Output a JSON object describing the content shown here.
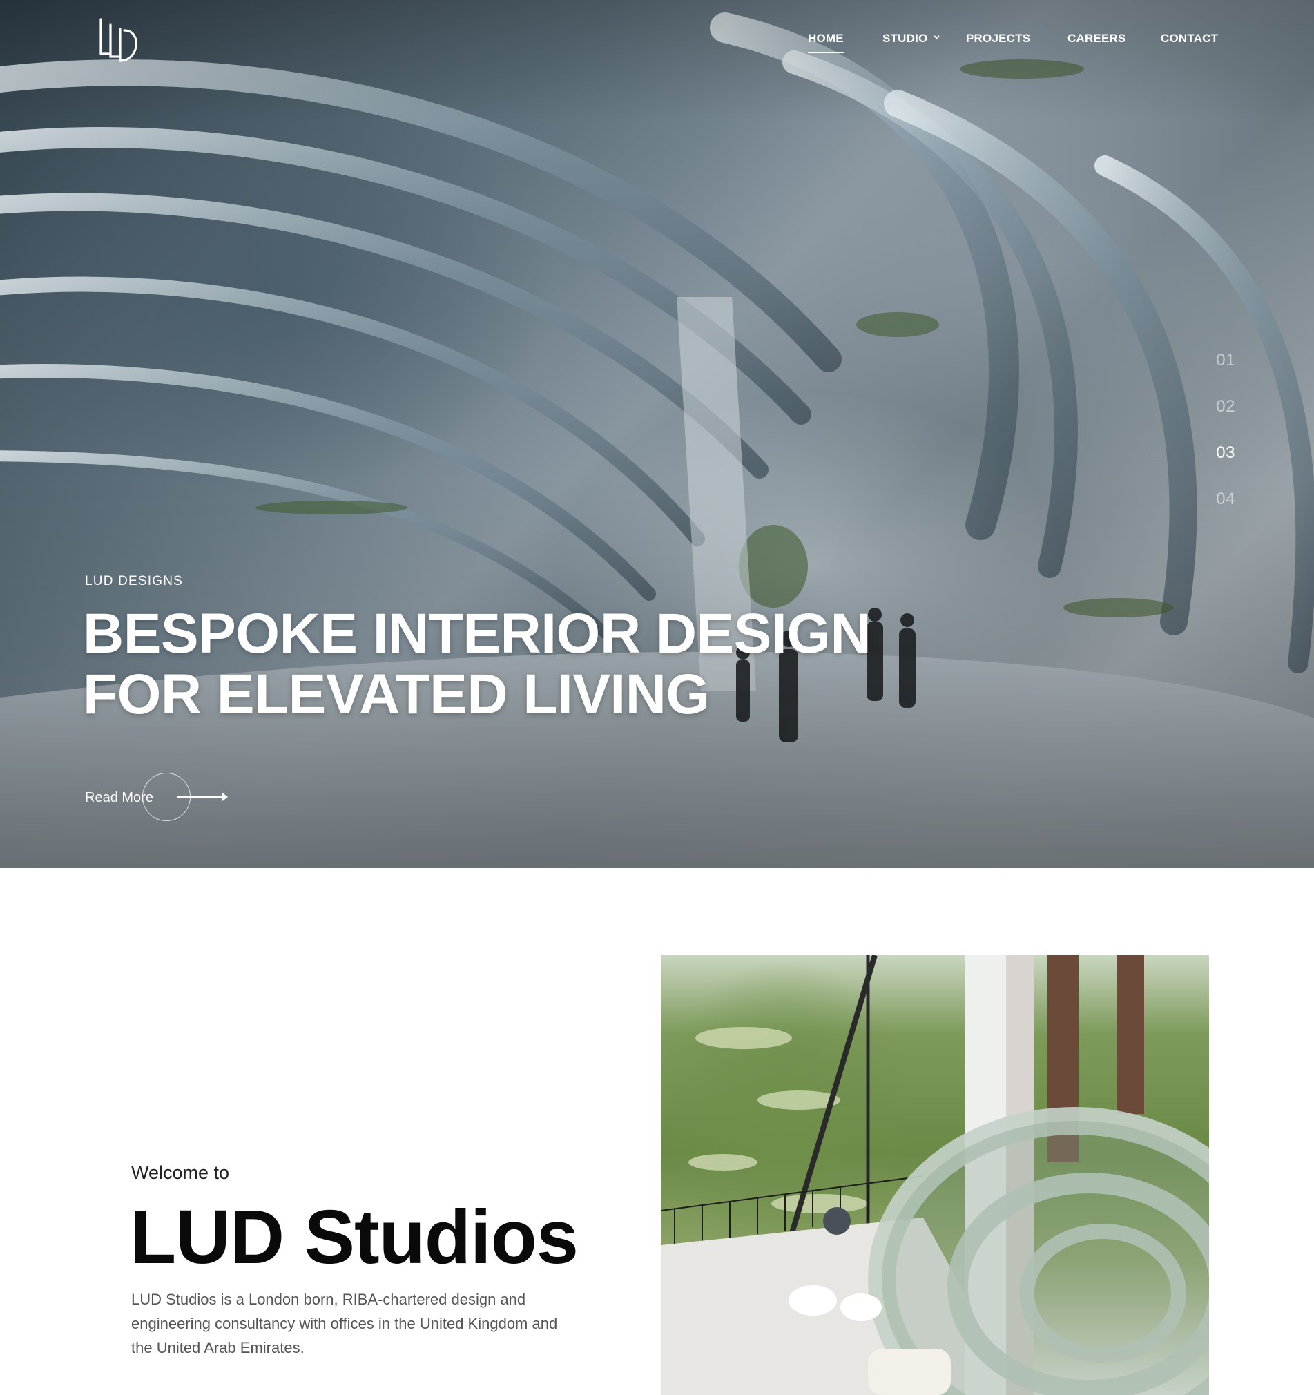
{
  "brand": {
    "logo_text": "LLD"
  },
  "nav": {
    "items": [
      {
        "label": "HOME",
        "active": true
      },
      {
        "label": "STUDIO",
        "has_dropdown": true
      },
      {
        "label": "PROJECTS"
      },
      {
        "label": "CAREERS"
      },
      {
        "label": "CONTACT"
      }
    ]
  },
  "hero": {
    "eyebrow": "LUD DESIGNS",
    "headline_line1": "BESPOKE INTERIOR DESIGN",
    "headline_line2": "FOR ELEVATED LIVING",
    "cta_label": "Read More",
    "slides": [
      "01",
      "02",
      "03",
      "04"
    ],
    "active_slide": "03"
  },
  "about": {
    "welcome": "Welcome to",
    "title": "LUD Studios",
    "body": "LUD Studios is a London born, RIBA-chartered design and engineering consultancy with offices in the United Kingdom and the United Arab Emirates."
  },
  "colors": {
    "accent": "#ffffff",
    "text_dark": "#0a0a0a",
    "text_body": "#555555"
  }
}
